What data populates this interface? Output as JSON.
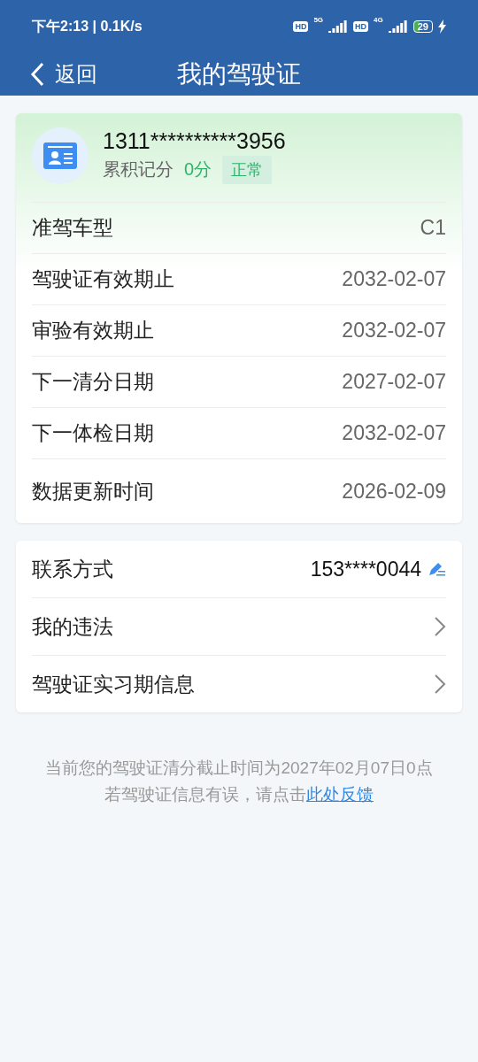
{
  "status_bar": {
    "time_speed": "下午2:13 | 0.1K/s",
    "sims": [
      {
        "hd": "HD",
        "network": "5G"
      },
      {
        "hd": "HD",
        "network": "4G"
      }
    ],
    "battery": "29",
    "charging": true
  },
  "header": {
    "back": "返回",
    "title": "我的驾驶证"
  },
  "license": {
    "number": "1311**********3956",
    "points_label": "累积记分",
    "points": "0分",
    "status": "正常",
    "rows": [
      {
        "label": "准驾车型",
        "value": "C1"
      },
      {
        "label": "驾驶证有效期止",
        "value": "2032-02-07"
      },
      {
        "label": "审验有效期止",
        "value": "2032-02-07"
      },
      {
        "label": "下一清分日期",
        "value": "2027-02-07"
      },
      {
        "label": "下一体检日期",
        "value": "2032-02-07"
      },
      {
        "label": "数据更新时间",
        "value": "2026-02-09"
      }
    ]
  },
  "menu": [
    {
      "kind": "edit",
      "label": "联系方式",
      "value": "153****0044"
    },
    {
      "kind": "link",
      "label": "我的违法"
    },
    {
      "kind": "link",
      "label": "驾驶证实习期信息"
    }
  ],
  "footnote": {
    "line1": "当前您的驾驶证清分截止时间为2027年02月07日0点",
    "line2": "若驾驶证信息有误，请点击",
    "link": "此处反馈"
  }
}
